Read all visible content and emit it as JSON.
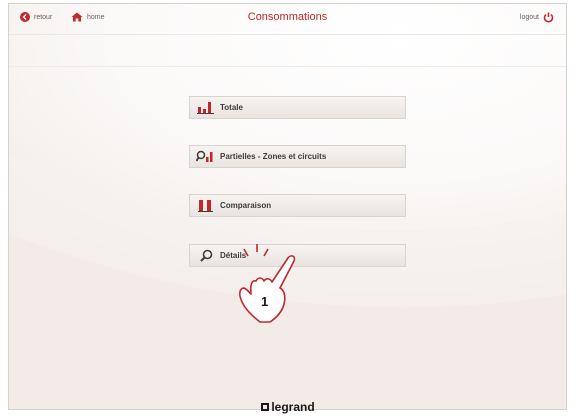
{
  "header": {
    "title": "Consommations",
    "back_label": "retour",
    "home_label": "home",
    "logout_label": "logout"
  },
  "menu": {
    "items": [
      {
        "label": "Totale",
        "icon": "bar-chart-icon"
      },
      {
        "label": "Partielles - Zones et circuits",
        "icon": "search-chart-icon"
      },
      {
        "label": "Comparaison",
        "icon": "compare-bars-icon"
      },
      {
        "label": "Détails",
        "icon": "search-icon"
      }
    ]
  },
  "callout": {
    "number": "1"
  },
  "footer": {
    "brand": "legrand"
  },
  "colors": {
    "accent": "#c0282b",
    "text": "#3f3b39",
    "button_bg": "#ede8e4"
  }
}
